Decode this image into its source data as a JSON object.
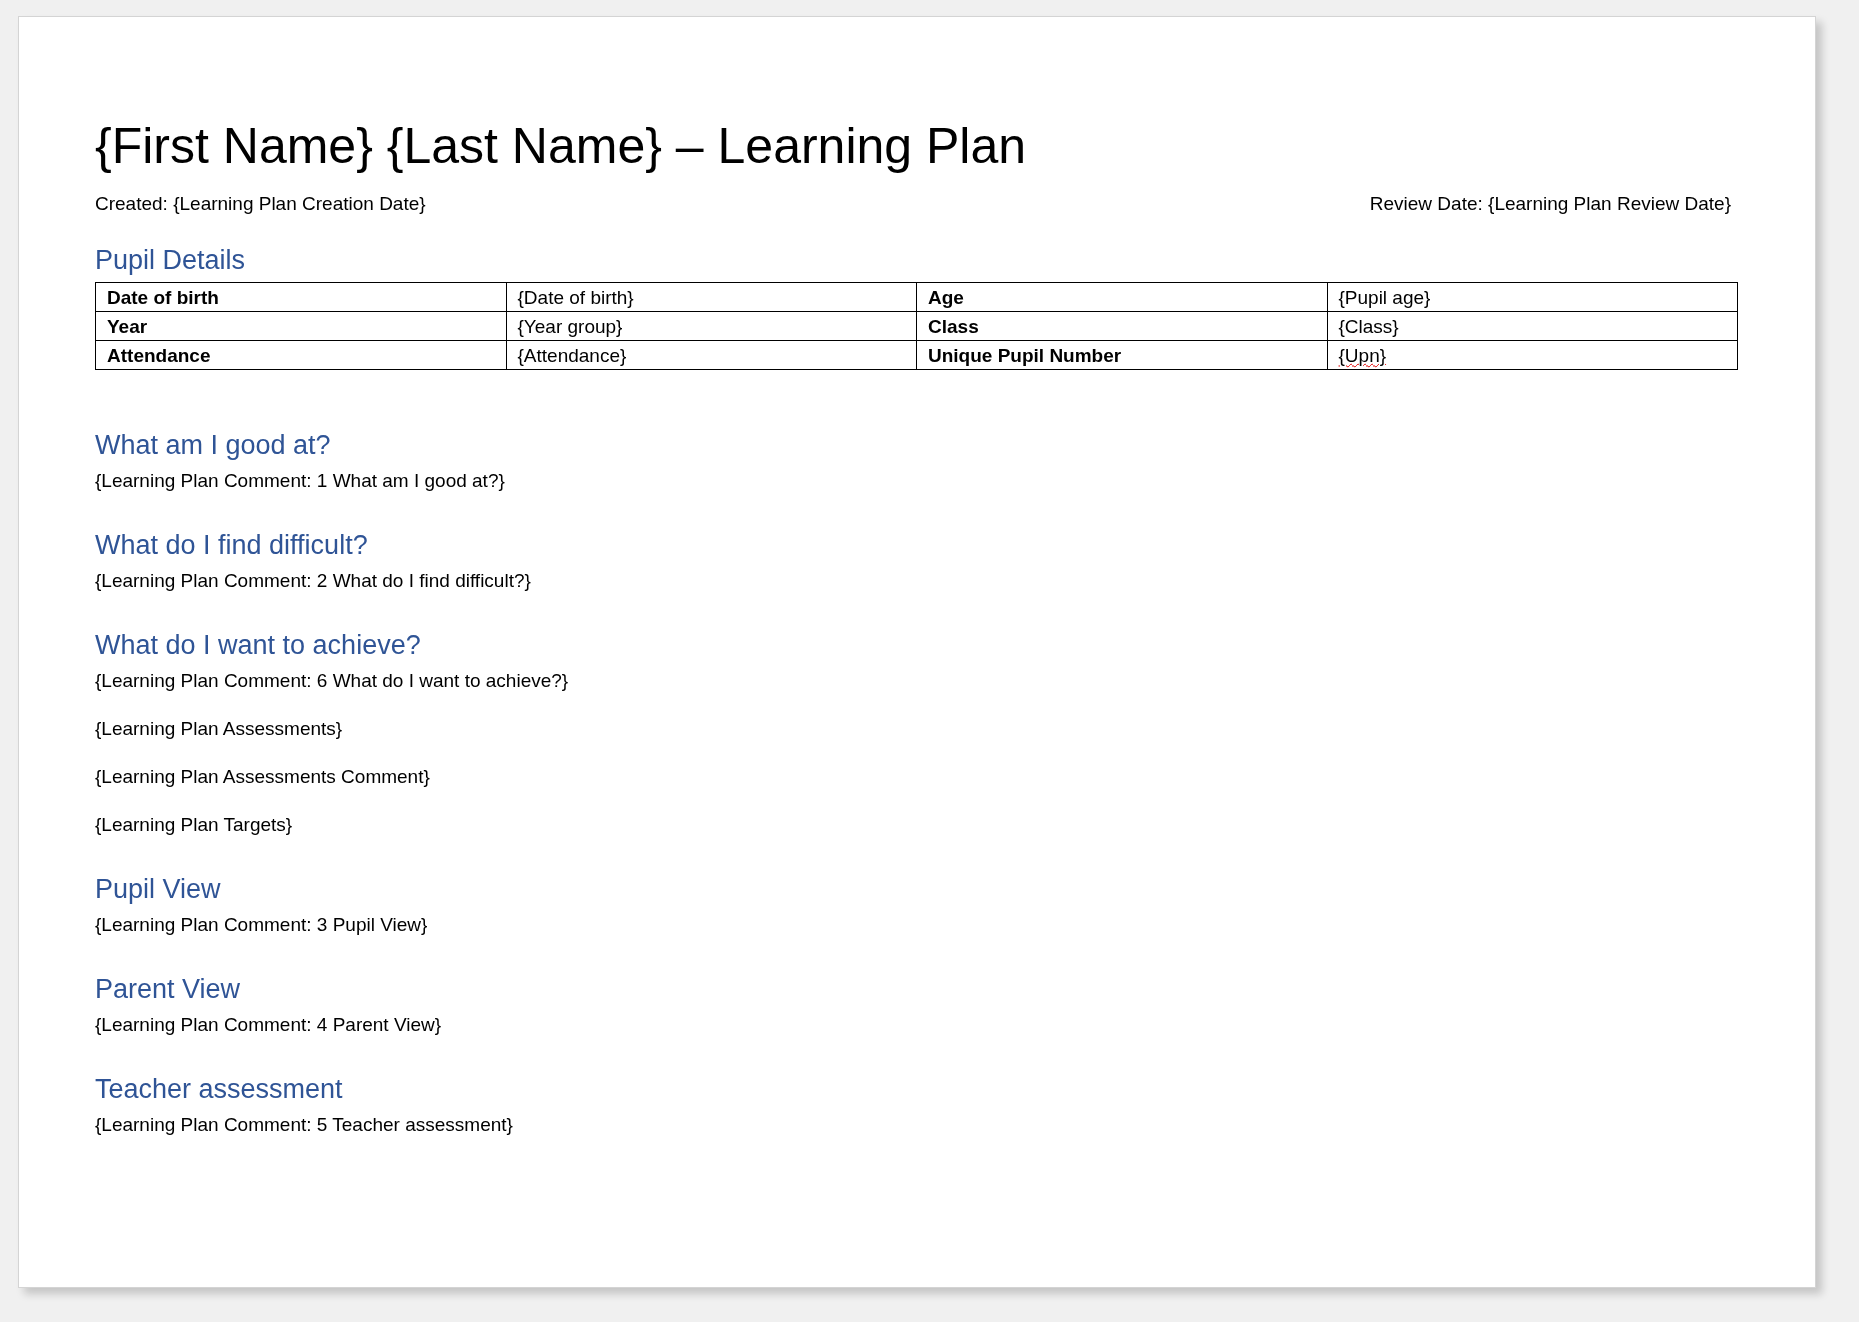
{
  "title": "{First Name} {Last Name} – Learning Plan",
  "created": "Created: {Learning Plan Creation Date}",
  "review_date": "Review Date: {Learning Plan Review Date}",
  "pupil_details": {
    "heading": "Pupil Details",
    "rows": [
      [
        {
          "text": "Date of birth",
          "kind": "label",
          "misspelled": false
        },
        {
          "text": "{Date of birth}",
          "kind": "value",
          "misspelled": false
        },
        {
          "text": "Age",
          "kind": "label",
          "misspelled": false
        },
        {
          "text": "{Pupil age}",
          "kind": "value",
          "misspelled": false
        }
      ],
      [
        {
          "text": "Year",
          "kind": "label",
          "misspelled": false
        },
        {
          "text": "{Year group}",
          "kind": "value",
          "misspelled": false
        },
        {
          "text": "Class",
          "kind": "label",
          "misspelled": false
        },
        {
          "text": "{Class}",
          "kind": "value",
          "misspelled": false
        }
      ],
      [
        {
          "text": "Attendance",
          "kind": "label",
          "misspelled": false
        },
        {
          "text": "{Attendance}",
          "kind": "value",
          "misspelled": false
        },
        {
          "text": "Unique Pupil Number",
          "kind": "label",
          "misspelled": false
        },
        {
          "text": "{Upn}",
          "kind": "value",
          "misspelled": true
        }
      ]
    ]
  },
  "sections": [
    {
      "heading": "What am I good at?",
      "paragraphs": [
        "{Learning Plan Comment: 1 What am I good at?}"
      ]
    },
    {
      "heading": "What do I find difficult?",
      "paragraphs": [
        "{Learning Plan Comment: 2 What do I find difficult?}"
      ]
    },
    {
      "heading": "What do I want to achieve?",
      "paragraphs": [
        "{Learning Plan Comment: 6 What do I want to achieve?}",
        "{Learning Plan Assessments}",
        "{Learning Plan Assessments Comment}",
        "{Learning Plan Targets}"
      ]
    },
    {
      "heading": "Pupil View",
      "paragraphs": [
        "{Learning Plan Comment: 3 Pupil View}"
      ]
    },
    {
      "heading": "Parent View",
      "paragraphs": [
        "{Learning Plan Comment: 4 Parent View}"
      ]
    },
    {
      "heading": "Teacher assessment",
      "paragraphs": [
        "{Learning Plan Comment: 5 Teacher assessment}"
      ]
    }
  ]
}
